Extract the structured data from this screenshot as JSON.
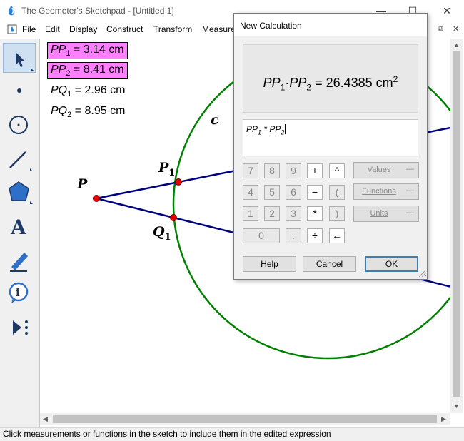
{
  "window": {
    "title": "The Geometer's Sketchpad - [Untitled 1]",
    "minimize": "—",
    "maximize": "☐",
    "close": "✕",
    "doc_restore": "⧉",
    "doc_close": "✕"
  },
  "menu": [
    "File",
    "Edit",
    "Display",
    "Construct",
    "Transform",
    "Measure"
  ],
  "toolbox": [
    "arrow-tool",
    "point-tool",
    "compass-tool",
    "straightedge-tool",
    "polygon-tool",
    "text-tool",
    "marker-tool",
    "information-tool",
    "custom-tool"
  ],
  "measurements": [
    {
      "name": "PP",
      "sub": "1",
      "rest": " = 3.14 cm",
      "selected": true
    },
    {
      "name": "PP",
      "sub": "2",
      "rest": " = 8.41 cm",
      "selected": true
    },
    {
      "name": "PQ",
      "sub": "1",
      "rest": " = 2.96 cm",
      "selected": false
    },
    {
      "name": "PQ",
      "sub": "2",
      "rest": " = 8.95 cm",
      "selected": false
    }
  ],
  "labels": {
    "P": "P",
    "P1_main": "P",
    "P1_sub": "1",
    "Q1_main": "Q",
    "Q1_sub": "1",
    "c": "c"
  },
  "status": "Click measurements or functions in the sketch to include them in the edited expression",
  "dialog": {
    "title": "New Calculation",
    "result": {
      "a": "PP",
      "a_sub": "1",
      "dot": "·",
      "b": "PP",
      "b_sub": "2",
      "rest": " = 26.4385 cm",
      "sup": "2"
    },
    "expression": {
      "a": "PP",
      "a_sub": "1",
      "op": " * ",
      "b": "PP",
      "b_sub": "2"
    },
    "keypad": [
      [
        "7",
        "8",
        "9",
        "+",
        "^"
      ],
      [
        "4",
        "5",
        "6",
        "−",
        "("
      ],
      [
        "1",
        "2",
        "3",
        "*",
        ")"
      ],
      [
        "0",
        ".",
        "÷",
        "←"
      ]
    ],
    "values_label": "Values",
    "functions_label": "Functions",
    "units_label": "Units",
    "popup_dash": "—",
    "help": "Help",
    "cancel": "Cancel",
    "ok": "OK"
  },
  "colors": {
    "selection": "#ff80ff",
    "segment": "#00007f",
    "circle": "#008000",
    "point": "#e00000"
  }
}
